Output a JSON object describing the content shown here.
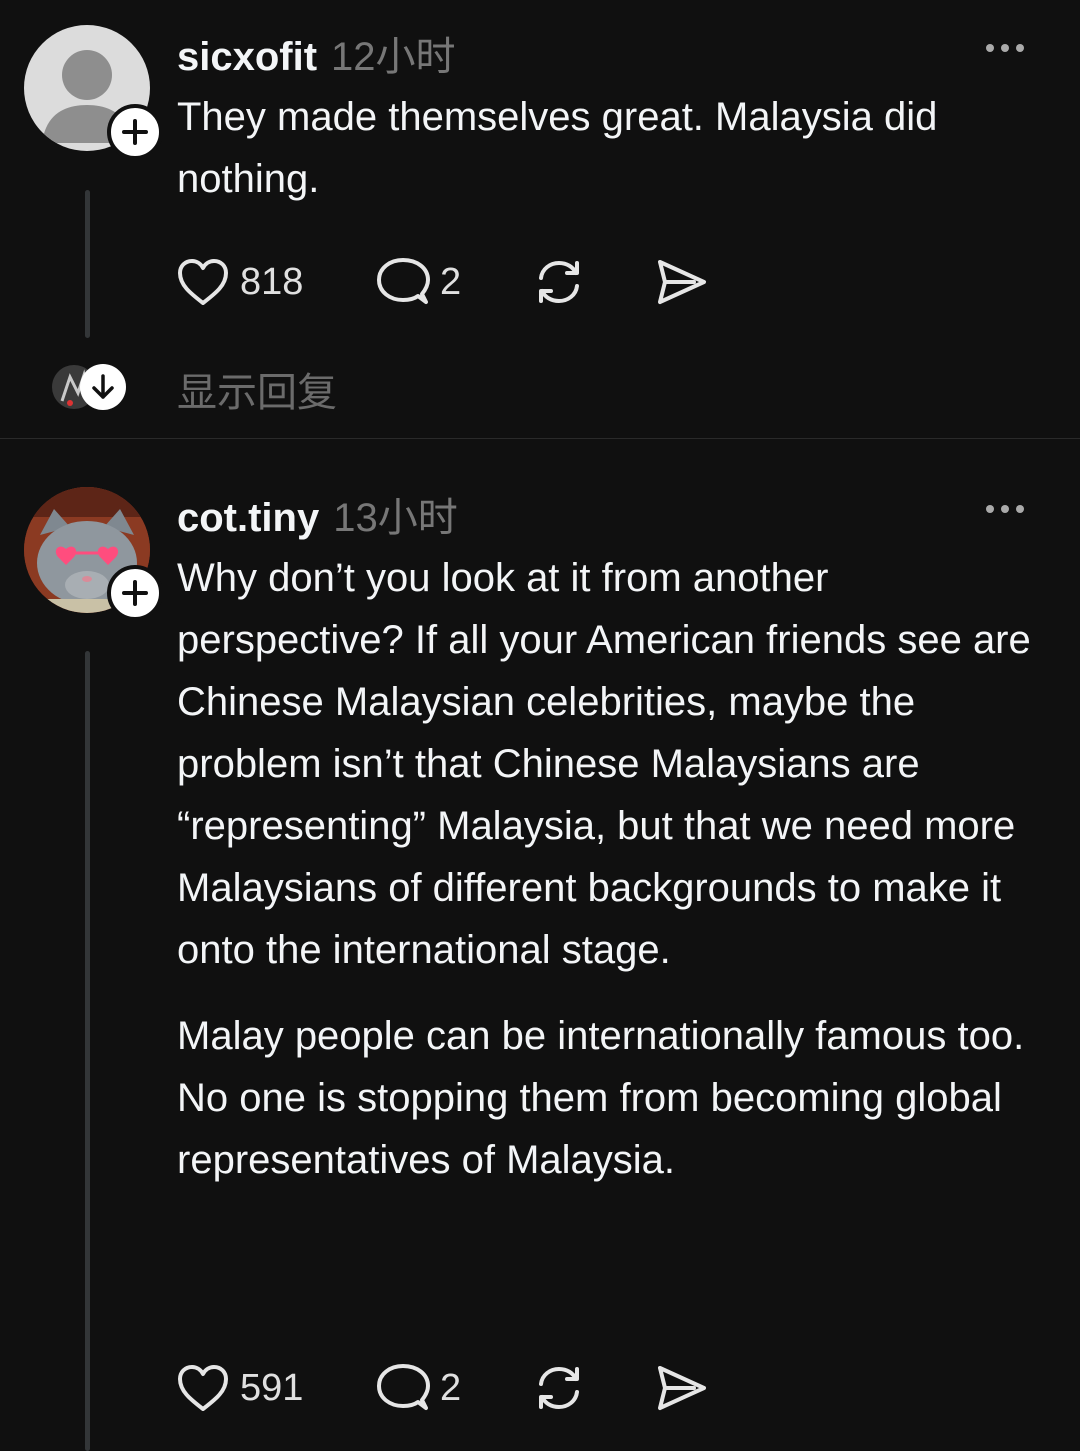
{
  "posts": [
    {
      "username": "sicxofit",
      "timestamp": "12小时",
      "paragraphs": [
        "They made themselves great. Malaysia did nothing."
      ],
      "likes": "818",
      "comments": "2",
      "show_replies": "显示回复"
    },
    {
      "username": "cot.tiny",
      "timestamp": "13小时",
      "paragraphs": [
        "Why don’t you look at it from another perspective? If all your American friends see are Chinese Malaysian celebrities, maybe the problem isn’t that Chinese Malaysians are “representing” Malaysia, but that we need more Malaysians of different backgrounds to make it onto the international stage.",
        "Malay people can be internationally famous too. No one is stopping them from becoming global representatives of Malaysia."
      ],
      "likes": "591",
      "comments": "2"
    }
  ],
  "icons": {
    "like": "heart-icon",
    "comment": "comment-bubble-icon",
    "repost": "repost-icon",
    "share": "send-icon",
    "more": "more-horizontal-icon",
    "follow": "plus-icon",
    "expand": "arrow-down-icon"
  },
  "colors": {
    "background": "#101010",
    "text": "#f3f5f7",
    "secondary_text": "#777777",
    "thread_line": "#333638"
  }
}
